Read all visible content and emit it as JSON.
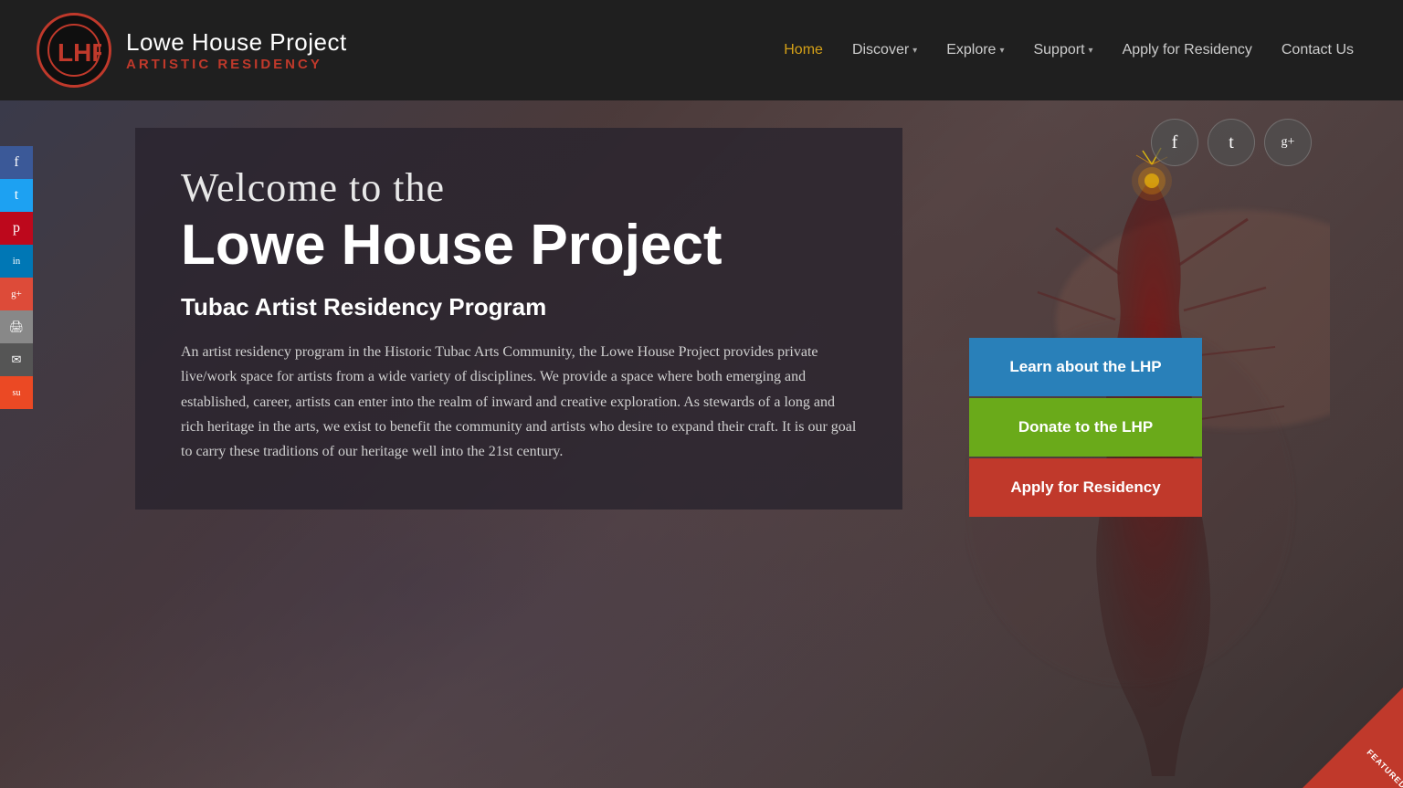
{
  "header": {
    "logo": {
      "title": "Lowe House Project",
      "subtitle": "ARTISTIC RESIDENCY"
    },
    "nav": {
      "items": [
        {
          "label": "Home",
          "active": true,
          "dropdown": false
        },
        {
          "label": "Discover",
          "active": false,
          "dropdown": true
        },
        {
          "label": "Explore",
          "active": false,
          "dropdown": true
        },
        {
          "label": "Support",
          "active": false,
          "dropdown": true
        },
        {
          "label": "Apply for Residency",
          "active": false,
          "dropdown": false
        },
        {
          "label": "Contact Us",
          "active": false,
          "dropdown": false
        }
      ]
    }
  },
  "hero": {
    "welcome_line1": "Welcome to the",
    "welcome_line2": "Lowe House Project",
    "subtitle": "Tubac Artist Residency Program",
    "description": "An artist residency program in the Historic Tubac Arts Community, the Lowe House Project provides private live/work space for artists from a wide variety of disciplines. We provide a space where both emerging and established, career, artists can enter into the realm of inward and creative exploration. As stewards of a long and rich heritage in the arts, we exist to benefit the community and artists who desire to expand their craft. It is our goal to carry these traditions of our heritage well into the 21st century.",
    "cta_buttons": [
      {
        "label": "Learn about the LHP",
        "color": "blue"
      },
      {
        "label": "Donate to the LHP",
        "color": "green"
      },
      {
        "label": "Apply for Residency",
        "color": "red"
      }
    ],
    "social_icons": [
      {
        "name": "facebook",
        "symbol": "f"
      },
      {
        "name": "twitter",
        "symbol": "t"
      },
      {
        "name": "googleplus",
        "symbol": "g+"
      }
    ]
  },
  "sidebar": {
    "items": [
      {
        "name": "facebook",
        "color": "#3b5998",
        "symbol": "f"
      },
      {
        "name": "twitter",
        "color": "#1da1f2",
        "symbol": "t"
      },
      {
        "name": "pinterest",
        "color": "#bd081c",
        "symbol": "p"
      },
      {
        "name": "linkedin",
        "color": "#0077b5",
        "symbol": "in"
      },
      {
        "name": "googleplus",
        "color": "#dd4b39",
        "symbol": "g+"
      },
      {
        "name": "print",
        "color": "#888888",
        "symbol": "🖨"
      },
      {
        "name": "email",
        "color": "#555555",
        "symbol": "✉"
      },
      {
        "name": "stumbleupon",
        "color": "#eb4924",
        "symbol": "su"
      }
    ]
  },
  "colors": {
    "accent_orange": "#c0392b",
    "nav_active": "#d4a017",
    "cta_blue": "#2980b9",
    "cta_green": "#6aaa1a",
    "cta_red": "#c0392b"
  }
}
